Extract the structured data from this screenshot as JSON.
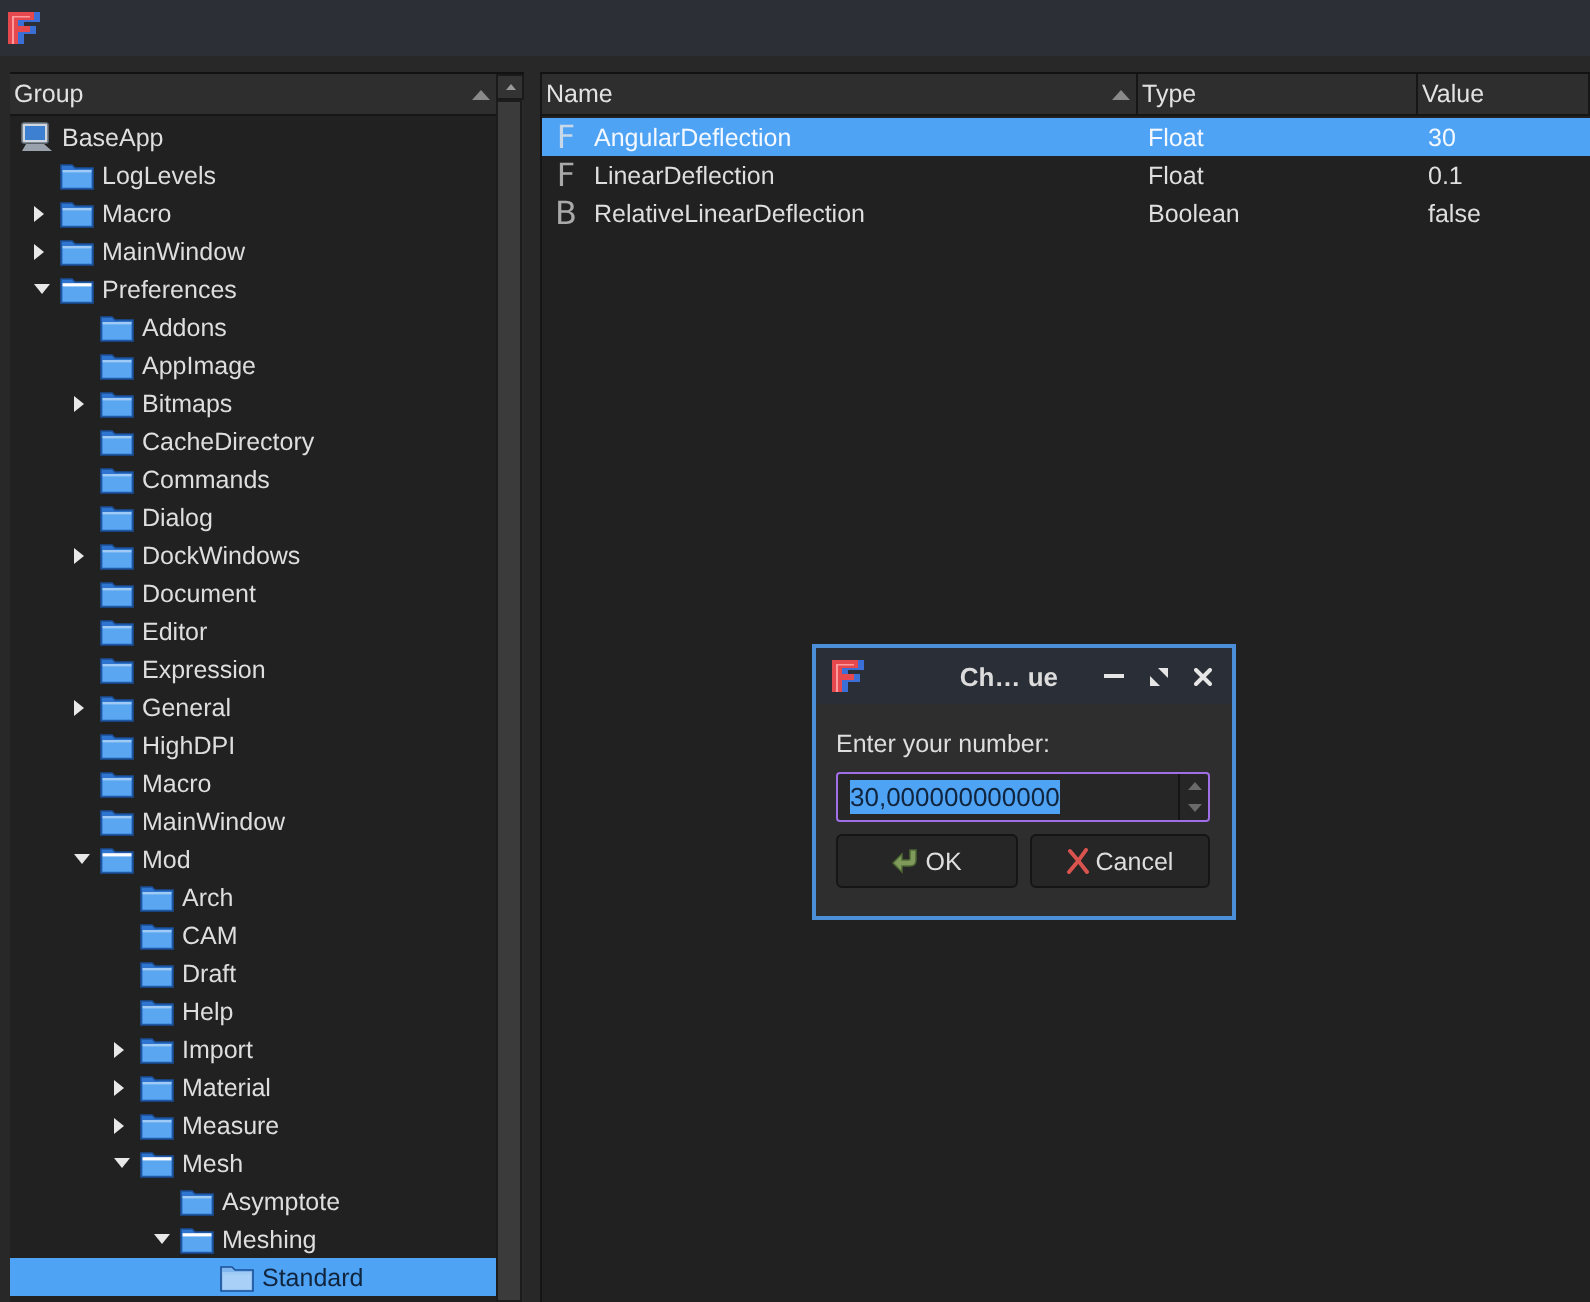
{
  "tree": {
    "header": {
      "label": "Group",
      "sorted": true
    },
    "root": {
      "label": "BaseApp",
      "selected": false,
      "children": [
        {
          "label": "LogLevels",
          "expandable": false,
          "expanded": false,
          "selected": false
        },
        {
          "label": "Macro",
          "expandable": true,
          "expanded": false,
          "selected": false
        },
        {
          "label": "MainWindow",
          "expandable": true,
          "expanded": false,
          "selected": false
        },
        {
          "label": "Preferences",
          "expandable": true,
          "expanded": true,
          "selected": false,
          "children": [
            {
              "label": "Addons",
              "expandable": false,
              "expanded": false,
              "selected": false
            },
            {
              "label": "AppImage",
              "expandable": false,
              "expanded": false,
              "selected": false
            },
            {
              "label": "Bitmaps",
              "expandable": true,
              "expanded": false,
              "selected": false
            },
            {
              "label": "CacheDirectory",
              "expandable": false,
              "expanded": false,
              "selected": false
            },
            {
              "label": "Commands",
              "expandable": false,
              "expanded": false,
              "selected": false
            },
            {
              "label": "Dialog",
              "expandable": false,
              "expanded": false,
              "selected": false
            },
            {
              "label": "DockWindows",
              "expandable": true,
              "expanded": false,
              "selected": false
            },
            {
              "label": "Document",
              "expandable": false,
              "expanded": false,
              "selected": false
            },
            {
              "label": "Editor",
              "expandable": false,
              "expanded": false,
              "selected": false
            },
            {
              "label": "Expression",
              "expandable": false,
              "expanded": false,
              "selected": false
            },
            {
              "label": "General",
              "expandable": true,
              "expanded": false,
              "selected": false
            },
            {
              "label": "HighDPI",
              "expandable": false,
              "expanded": false,
              "selected": false
            },
            {
              "label": "Macro",
              "expandable": false,
              "expanded": false,
              "selected": false
            },
            {
              "label": "MainWindow",
              "expandable": false,
              "expanded": false,
              "selected": false
            },
            {
              "label": "Mod",
              "expandable": true,
              "expanded": true,
              "selected": false,
              "children": [
                {
                  "label": "Arch",
                  "expandable": false,
                  "expanded": false,
                  "selected": false
                },
                {
                  "label": "CAM",
                  "expandable": false,
                  "expanded": false,
                  "selected": false
                },
                {
                  "label": "Draft",
                  "expandable": false,
                  "expanded": false,
                  "selected": false
                },
                {
                  "label": "Help",
                  "expandable": false,
                  "expanded": false,
                  "selected": false
                },
                {
                  "label": "Import",
                  "expandable": true,
                  "expanded": false,
                  "selected": false
                },
                {
                  "label": "Material",
                  "expandable": true,
                  "expanded": false,
                  "selected": false
                },
                {
                  "label": "Measure",
                  "expandable": true,
                  "expanded": false,
                  "selected": false
                },
                {
                  "label": "Mesh",
                  "expandable": true,
                  "expanded": true,
                  "selected": false,
                  "children": [
                    {
                      "label": "Asymptote",
                      "expandable": false,
                      "expanded": false,
                      "selected": false
                    },
                    {
                      "label": "Meshing",
                      "expandable": true,
                      "expanded": true,
                      "selected": false,
                      "children": [
                        {
                          "label": "Standard",
                          "expandable": false,
                          "expanded": false,
                          "selected": true
                        }
                      ]
                    }
                  ]
                }
              ]
            }
          ]
        }
      ]
    }
  },
  "table": {
    "columns": [
      {
        "label": "Name",
        "sorted": true
      },
      {
        "label": "Type",
        "sorted": false
      },
      {
        "label": "Value",
        "sorted": false
      }
    ],
    "rows": [
      {
        "icon": "F",
        "name": "AngularDeflection",
        "type": "Float",
        "value": "30",
        "selected": true
      },
      {
        "icon": "F",
        "name": "LinearDeflection",
        "type": "Float",
        "value": "0.1",
        "selected": false
      },
      {
        "icon": "B",
        "name": "RelativeLinearDeflection",
        "type": "Boolean",
        "value": "false",
        "selected": false
      }
    ]
  },
  "dialog": {
    "title": "Ch… ue",
    "prompt": "Enter your number:",
    "field": {
      "value": "30,000000000000",
      "focused": true,
      "text_selected": true
    },
    "buttons": [
      {
        "label": "OK",
        "kind": "ok"
      },
      {
        "label": "Cancel",
        "kind": "cancel"
      }
    ]
  }
}
